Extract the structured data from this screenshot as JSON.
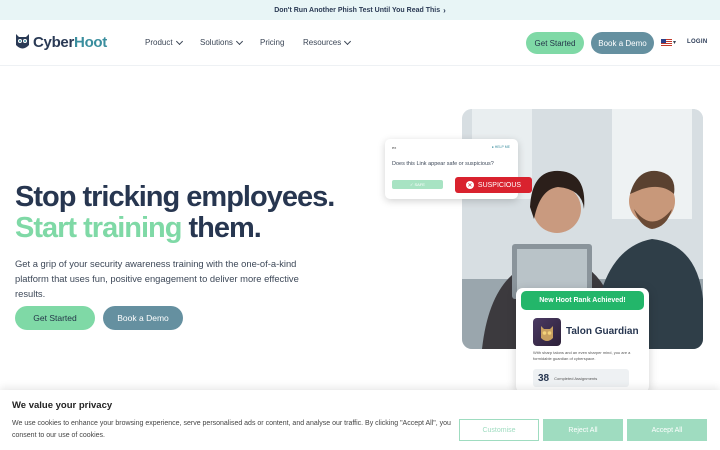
{
  "announcement": {
    "text": "Don't Run Another Phish Test Until You Read This",
    "chevron": "›"
  },
  "nav": {
    "logo": {
      "part1": "Cyber",
      "part2": "Hoot"
    },
    "items": [
      {
        "label": "Product",
        "has_caret": true
      },
      {
        "label": "Solutions",
        "has_caret": true
      },
      {
        "label": "Pricing",
        "has_caret": false
      },
      {
        "label": "Resources",
        "has_caret": true
      }
    ],
    "get_started": "Get Started",
    "book_demo": "Book a Demo",
    "language_caret": "▾",
    "login": "LOGIN"
  },
  "hero": {
    "line1": "Stop tricking employees.",
    "line2_accent": "Start training",
    "line2_rest": " them.",
    "subtitle": "Get a grip of your security awareness training with the one-of-a-kind platform that uses fun, positive engagement to deliver more effective results.",
    "cta_primary": "Get Started",
    "cta_secondary": "Book a Demo"
  },
  "quiz_card": {
    "example_label": "ex",
    "help_label": "● HELP ME",
    "question": "Does this Link appear safe or suspicious?",
    "safe_label": "✓ SAFE",
    "suspicious_label": "SUSPICIOUS",
    "suspicious_icon": "✕"
  },
  "rank_card": {
    "header": "New Hoot Rank Achieved!",
    "rank_name": "Talon Guardian",
    "description": "With sharp talons and an even sharper mind, you are a formidable guardian of cyberspace.",
    "count": "38",
    "count_label": "Completed Assignments"
  },
  "cookie": {
    "title": "We value your privacy",
    "body": "We use cookies to enhance your browsing experience, serve personalised ads or content, and analyse our traffic. By clicking \"Accept All\", you consent to our use of cookies.",
    "customise": "Customise",
    "reject": "Reject All",
    "accept": "Accept All"
  },
  "colors": {
    "brand_dark": "#273650",
    "brand_teal": "#3a8e9e",
    "accent_green": "#7fd9a6",
    "slate": "#6590a0",
    "alert_red": "#d9222e",
    "success_green": "#23b66a"
  }
}
